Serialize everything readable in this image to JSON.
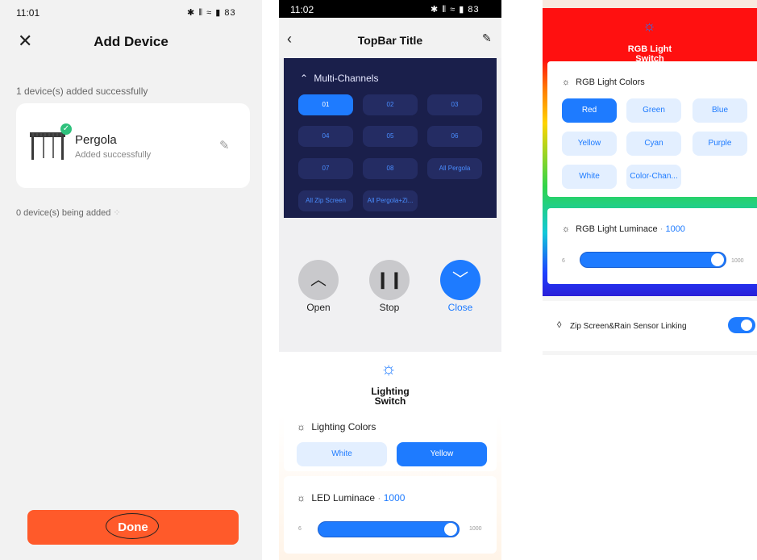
{
  "screen1": {
    "time": "11:01",
    "status_icons": "✱ ⦀ ≈ ▮ 83",
    "title": "Add Device",
    "added_text": "1 device(s) added successfully",
    "device": {
      "name": "Pergola",
      "status": "Added successfully"
    },
    "adding_text": "0 device(s) being added",
    "done_label": "Done",
    "done_color": "#ff5a2a"
  },
  "screen2": {
    "time": "11:02",
    "status_icons": "✱ ⦀ ≈ ▮ 83",
    "title": "TopBar Title",
    "multi_channels_title": "Multi-Channels",
    "channels": [
      "01",
      "02",
      "03",
      "04",
      "05",
      "06",
      "07",
      "08",
      "All Pergola",
      "All Zip Screen",
      "All Pergola+Zi..."
    ],
    "active_channel": "01",
    "controls": {
      "open": "Open",
      "stop": "Stop",
      "close": "Close"
    },
    "lighting_switch": "Lighting Switch",
    "lighting_colors_title": "Lighting Colors",
    "lighting_colors": [
      "White",
      "Yellow"
    ],
    "active_lighting_color": "Yellow",
    "led_luminance_title": "LED Luminace",
    "led_luminance_value": "1000",
    "slider_min": "6",
    "slider_max": "1000",
    "accent": "#1e7bff"
  },
  "screen3": {
    "rgb_switch_label": "RGB Light Switch",
    "rgb_colors_title": "RGB Light Colors",
    "rgb_colors": [
      "Red",
      "Green",
      "Blue",
      "Yellow",
      "Cyan",
      "Purple",
      "White",
      "Color-Chan..."
    ],
    "active_rgb_color": "Red",
    "rgb_luminance_title": "RGB Light Luminace",
    "rgb_luminance_value": "1000",
    "slider_min": "6",
    "slider_max": "1000",
    "zip_rain_label": "Zip Screen&Rain Sensor Linking",
    "zip_rain_enabled": true
  }
}
